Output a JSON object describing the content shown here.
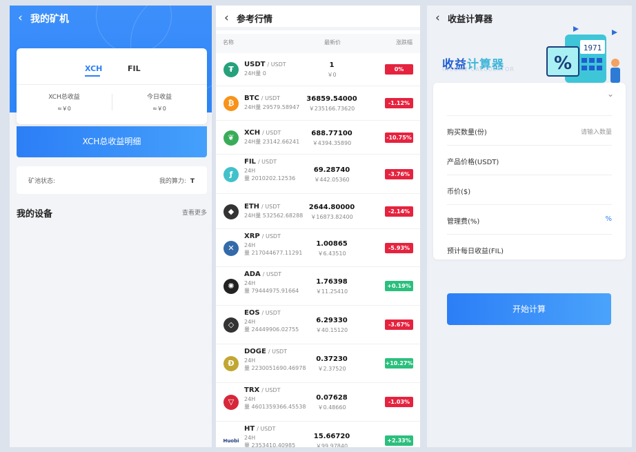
{
  "mining": {
    "back_icon": "chevron-left-icon",
    "title": "我的矿机",
    "tabs": [
      "XCH",
      "FIL"
    ],
    "active_tab": "XCH",
    "stats": [
      {
        "label": "XCH总收益",
        "value": "≈￥0"
      },
      {
        "label": "今日收益",
        "value": "≈￥0"
      }
    ],
    "detail_button": "XCH总收益明细",
    "pool_status_label": "矿池状态:",
    "hashrate_label": "我的算力:",
    "hashrate_value": "T",
    "devices_title": "我的设备",
    "view_more": "查看更多",
    "accent_color": "#2d7ff7"
  },
  "market": {
    "back_icon": "chevron-left-icon",
    "title": "参考行情",
    "columns": {
      "name": "名称",
      "price": "最新价",
      "change": "涨跌幅"
    },
    "rows": [
      {
        "icon": "tether-icon",
        "symbol": "USDT",
        "quote": "/ USDT",
        "vol": "24H量 0",
        "price": "1",
        "cny": "￥0",
        "change": "0%",
        "color": "#26a17b"
      },
      {
        "icon": "bitcoin-icon",
        "symbol": "BTC",
        "quote": "/ USDT",
        "vol": "24H量 29579.58947",
        "price": "36859.54000",
        "cny": "￥235166.73620",
        "change": "-1.12%",
        "color": "#f7931a"
      },
      {
        "icon": "chia-icon",
        "symbol": "XCH",
        "quote": "/ USDT",
        "vol": "24H量 23142.66241",
        "price": "688.77100",
        "cny": "￥4394.35890",
        "change": "-10.75%",
        "color": "#3aac59"
      },
      {
        "icon": "filecoin-icon",
        "symbol": "FIL",
        "quote": "/ USDT",
        "vol": "24H\n量 2010202.12536",
        "price": "69.28740",
        "cny": "￥442.05360",
        "change": "-3.76%",
        "color": "#42c1ca"
      },
      {
        "icon": "ethereum-icon",
        "symbol": "ETH",
        "quote": "/ USDT",
        "vol": "24H量 532562.68288",
        "price": "2644.80000",
        "cny": "￥16873.82400",
        "change": "-2.14%",
        "color": "#333333"
      },
      {
        "icon": "ripple-icon",
        "symbol": "XRP",
        "quote": "/ USDT",
        "vol": "24H\n量 217044677.11291",
        "price": "1.00865",
        "cny": "￥6.43510",
        "change": "-5.93%",
        "color": "#346aa9"
      },
      {
        "icon": "cardano-icon",
        "symbol": "ADA",
        "quote": "/ USDT",
        "vol": "24H\n量 79444975.91664",
        "price": "1.76398",
        "cny": "￥11.25410",
        "change": "+0.19%",
        "color": "#222222"
      },
      {
        "icon": "eos-icon",
        "symbol": "EOS",
        "quote": "/ USDT",
        "vol": "24H\n量 24449906.02755",
        "price": "6.29330",
        "cny": "￥40.15120",
        "change": "-3.67%",
        "color": "#333333"
      },
      {
        "icon": "dogecoin-icon",
        "symbol": "DOGE",
        "quote": "/ USDT",
        "vol": "24H\n量 2230051690.46978",
        "price": "0.37230",
        "cny": "￥2.37520",
        "change": "+10.27%",
        "color": "#c2a633"
      },
      {
        "icon": "tron-icon",
        "symbol": "TRX",
        "quote": "/ USDT",
        "vol": "24H\n量 4601359366.45538",
        "price": "0.07628",
        "cny": "￥0.48660",
        "change": "-1.03%",
        "color": "#d7273a"
      },
      {
        "icon": "huobi-icon",
        "symbol": "HT",
        "quote": "/ USDT",
        "vol": "24H\n量 2353410.40985",
        "price": "15.66720",
        "cny": "￥99.97840",
        "change": "+2.33%",
        "color": "#1c3b7b",
        "logo_text": "Huobi"
      }
    ],
    "up_color": "#2bbf7d",
    "down_color": "#e5233f"
  },
  "calculator": {
    "back_icon": "chevron-left-icon",
    "title": "收益计算器",
    "banner_title_a": "收益",
    "banner_title_b": "计算器",
    "banner_subtitle": "INCOME CALCULATOR",
    "banner_icon": "calculator-illustration-icon",
    "dropdown_icon": "chevron-down-icon",
    "fields": [
      {
        "label": "购买数量(份)",
        "placeholder": "请输入数量"
      },
      {
        "label": "产品价格(USDT)"
      },
      {
        "label": "币价($)"
      },
      {
        "label": "管理费(%)",
        "unit": "%"
      },
      {
        "label": "预计每日收益(FIL)"
      }
    ],
    "start_button": "开始计算"
  }
}
